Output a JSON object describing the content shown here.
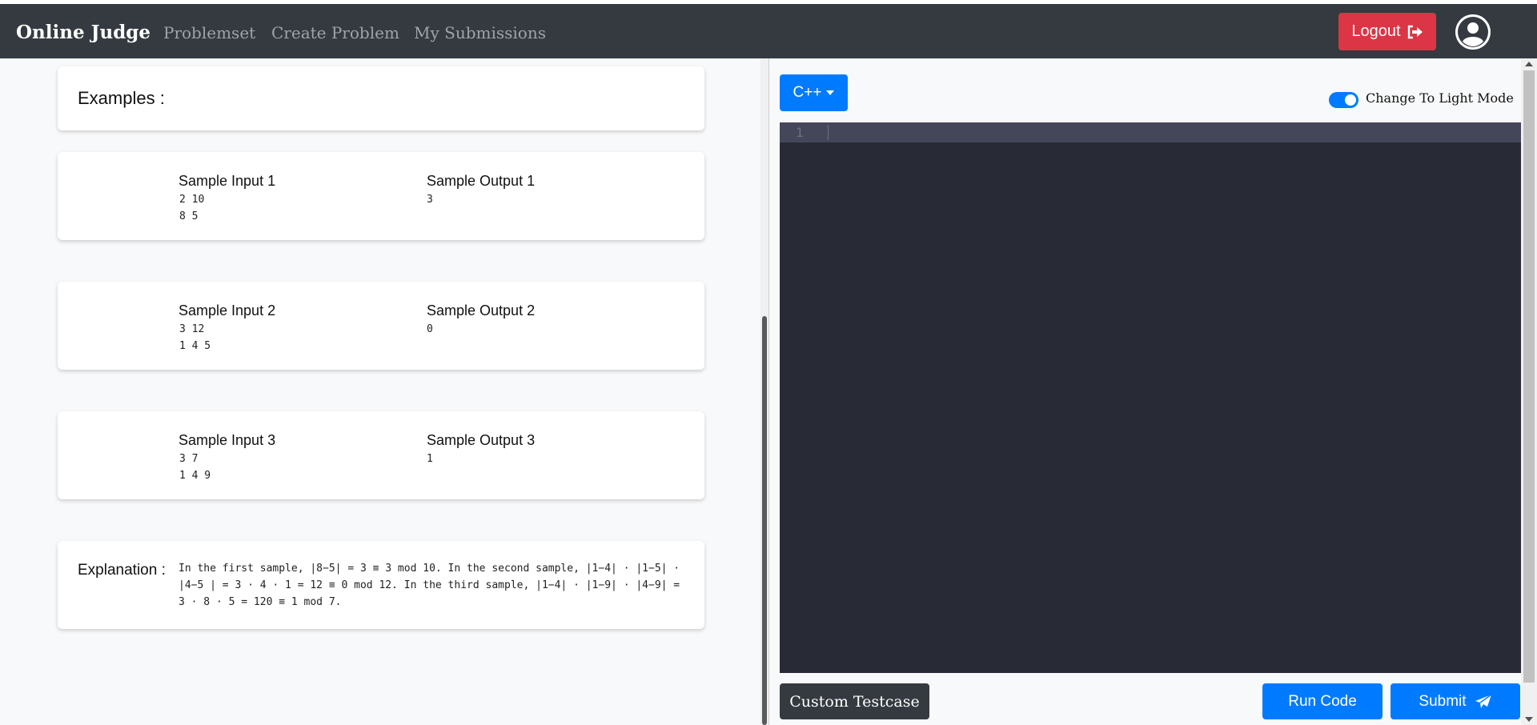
{
  "navbar": {
    "brand": "Online Judge",
    "links": [
      "Problemset",
      "Create Problem",
      "My Submissions"
    ],
    "logout_label": "Logout"
  },
  "examples": {
    "title": "Examples :",
    "samples": [
      {
        "input_label": "Sample Input 1",
        "input": "2 10\n8 5",
        "output_label": "Sample Output 1",
        "output": "3"
      },
      {
        "input_label": "Sample Input 2",
        "input": "3 12\n1 4 5",
        "output_label": "Sample Output 2",
        "output": "0"
      },
      {
        "input_label": "Sample Input 3",
        "input": "3 7\n1 4 9",
        "output_label": "Sample Output 3",
        "output": "1"
      }
    ],
    "explanation_label": "Explanation :",
    "explanation": "In the first sample, |8−5| = 3 ≡ 3 mod 10.  In the second sample, |1−4| · |1−5| · |4−5 | = 3 · 4 · 1 = 12 ≡ 0 mod 12.  In the third sample, |1−4| · |1−9| · |4−9| = 3 · 8 · 5 = 120 ≡ 1 mod 7."
  },
  "editor": {
    "language": "C++",
    "theme_toggle_label": "Change To Light Mode",
    "theme_toggle_on": true,
    "line_number": "1"
  },
  "actions": {
    "custom_testcase": "Custom Testcase",
    "run_code": "Run Code",
    "submit": "Submit"
  },
  "colors": {
    "navbar": "#343a40",
    "logout": "#dc3545",
    "primary": "#007bff",
    "editor_bg": "#282a36"
  }
}
